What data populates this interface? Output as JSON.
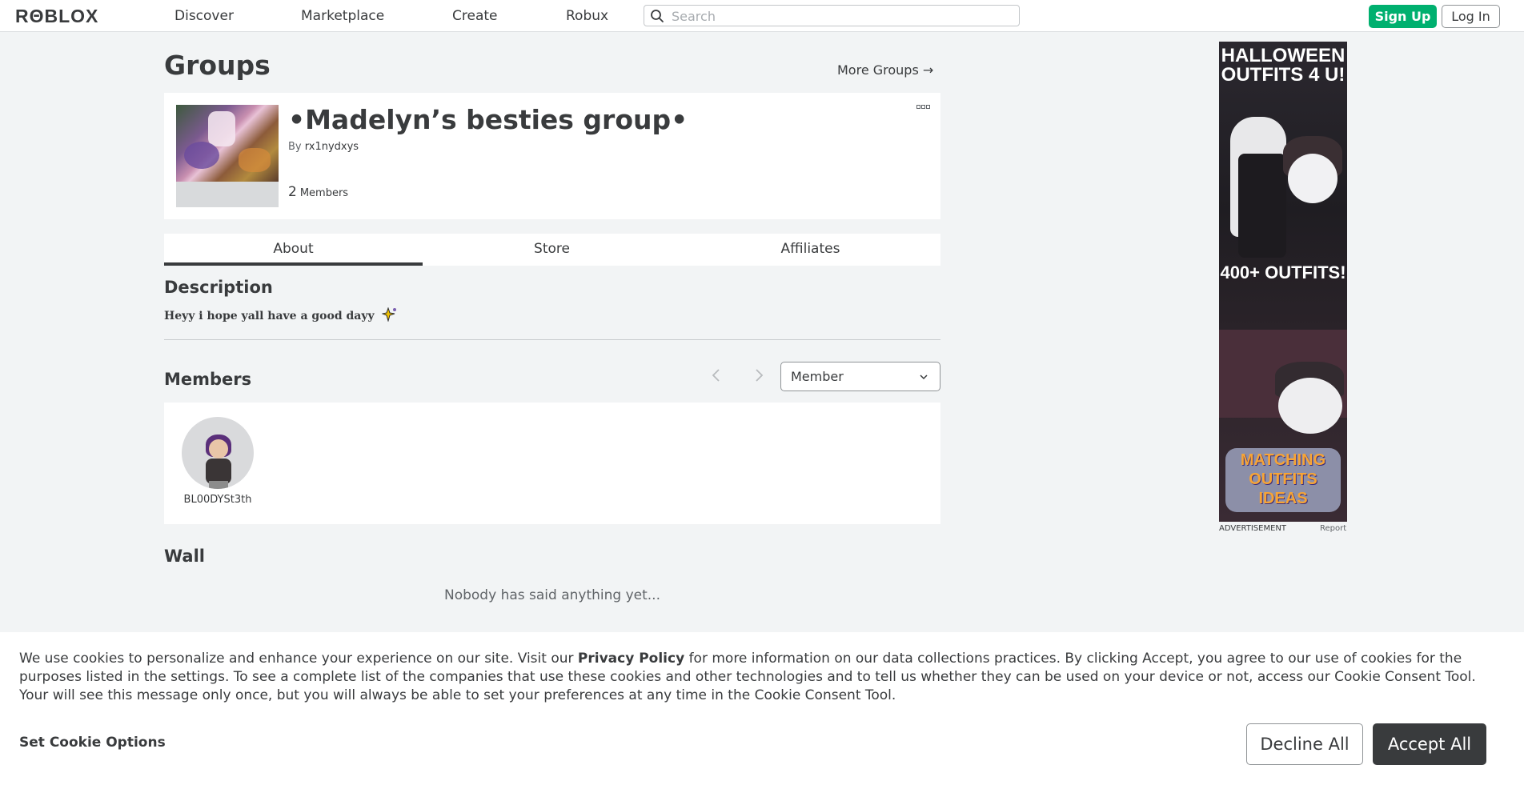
{
  "header": {
    "logo_text": "RΘBLOX",
    "nav": [
      "Discover",
      "Marketplace",
      "Create",
      "Robux"
    ],
    "search_placeholder": "Search",
    "signup_label": "Sign Up",
    "login_label": "Log In"
  },
  "page": {
    "title": "Groups",
    "more_groups": "More Groups →"
  },
  "group": {
    "name": "•Madelyn’s besties group•",
    "by_label": "By",
    "owner": "rx1nydxys",
    "member_count": "2",
    "members_label": "Members"
  },
  "tabs": [
    "About",
    "Store",
    "Affiliates"
  ],
  "about": {
    "description_title": "Description",
    "description_text": "Heyy i hope yall have a good dayy",
    "members_title": "Members",
    "role_select": "Member",
    "members": [
      {
        "name": "BL00DYSt3th"
      }
    ],
    "wall_title": "Wall",
    "wall_empty": "Nobody has said anything yet..."
  },
  "ad": {
    "line1": "HALLOWEEN",
    "line2": "OUTFITS 4 U!",
    "line3": "400+ OUTFITS!",
    "badge1": "MATCHING",
    "badge2": "OUTFITS",
    "badge3": "IDEAS",
    "label": "ADVERTISEMENT",
    "report": "Report"
  },
  "cookie": {
    "text_before": "We use cookies to personalize and enhance your experience on our site. Visit our ",
    "privacy_link": "Privacy Policy",
    "text_after": " for more information on our data collections practices. By clicking Accept, you agree to our use of cookies for the purposes listed in the settings. To see a complete list of the companies that use these cookies and other technologies and to tell us whether they can be used on your device or not, access our Cookie Consent Tool. Your will see this message only once, but you will always be able to set your preferences at any time in the Cookie Consent Tool.",
    "set_options": "Set Cookie Options",
    "decline": "Decline All",
    "accept": "Accept All"
  },
  "colors": {
    "accent_green": "#00b06f",
    "text_dark": "#393b3d",
    "page_bg": "#f2f4f5"
  }
}
